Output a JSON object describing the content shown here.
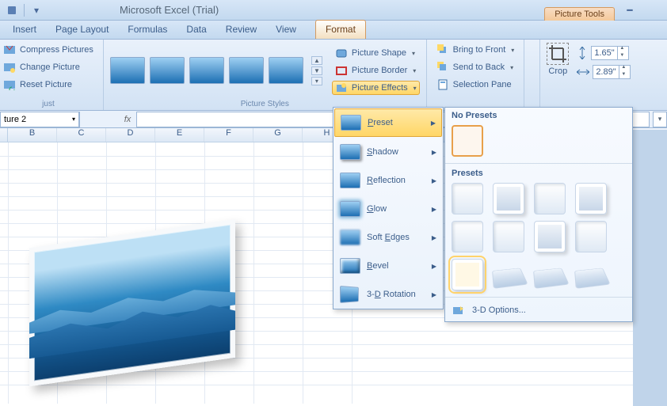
{
  "app": {
    "title": "Microsoft Excel (Trial)"
  },
  "context_tab": "Picture Tools",
  "tabs": [
    "Insert",
    "Page Layout",
    "Formulas",
    "Data",
    "Review",
    "View"
  ],
  "tabs_context": "Format",
  "ribbon": {
    "adjust": {
      "label_partial": "just",
      "compress": "Compress Pictures",
      "change": "Change Picture",
      "reset": "Reset Picture"
    },
    "styles": {
      "label": "Picture Styles",
      "shape": "Picture Shape",
      "border": "Picture Border",
      "effects": "Picture Effects"
    },
    "arrange": {
      "front": "Bring to Front",
      "back": "Send to Back",
      "pane": "Selection Pane"
    },
    "size": {
      "crop": "Crop",
      "height": "1.65\"",
      "width": "2.89\""
    }
  },
  "namebox_value": "ture 2",
  "columns": [
    "B",
    "C",
    "D",
    "E",
    "F",
    "G",
    "H"
  ],
  "effects_menu": {
    "items": [
      {
        "label": "Preset",
        "accel": "P"
      },
      {
        "label": "Shadow",
        "accel": "S"
      },
      {
        "label": "Reflection",
        "accel": "R"
      },
      {
        "label": "Glow",
        "accel": "G"
      },
      {
        "label": "Soft Edges",
        "accel": "E"
      },
      {
        "label": "Bevel",
        "accel": "B"
      },
      {
        "label": "3-D Rotation",
        "accel": "D"
      }
    ]
  },
  "preset_flyout": {
    "no_presets": "No Presets",
    "presets": "Presets",
    "options": "3-D Options...",
    "options_accel": "O"
  }
}
